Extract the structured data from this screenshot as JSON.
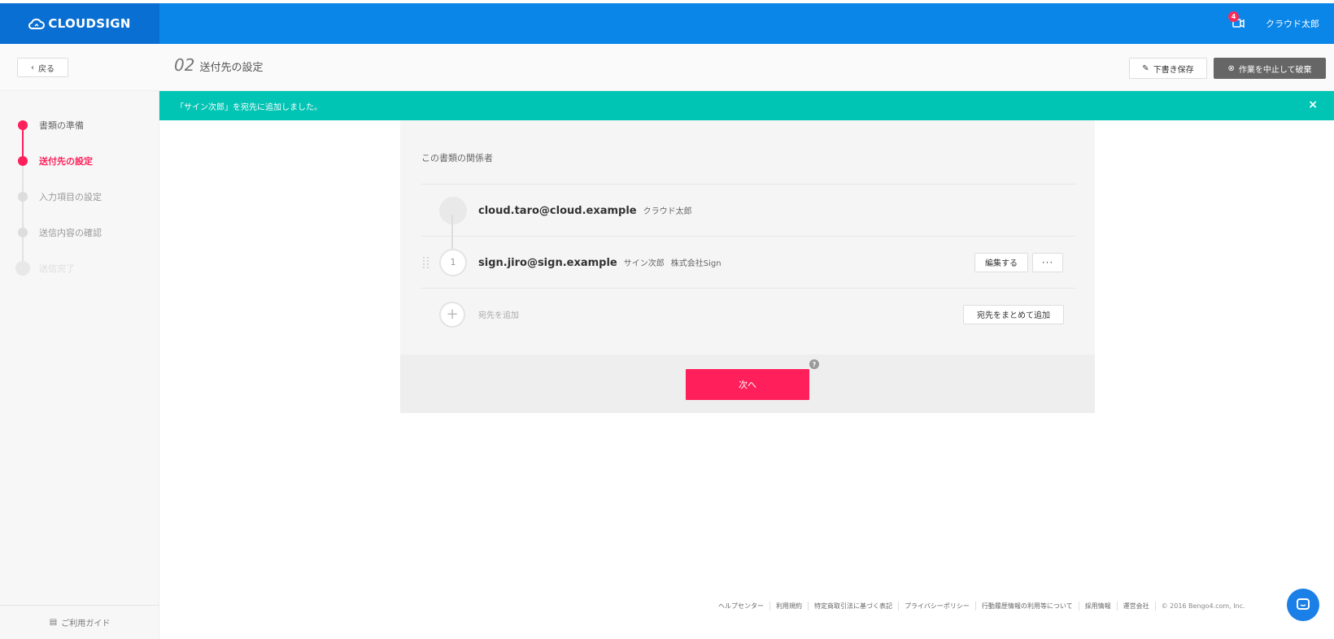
{
  "header": {
    "logo_text": "CLOUDSIGN",
    "notification_count": "4",
    "user_name": "クラウド太郎",
    "brand_color": "#0a86e8"
  },
  "subheader": {
    "back_label": "戻る",
    "step_number": "02",
    "step_title": "送付先の設定",
    "draft_label": "下書き保存",
    "abort_label": "作業を中止して破棄"
  },
  "sidebar": {
    "steps": [
      {
        "label": "書類の準備",
        "state": "done"
      },
      {
        "label": "送付先の設定",
        "state": "current"
      },
      {
        "label": "入力項目の設定",
        "state": "pending"
      },
      {
        "label": "送信内容の確認",
        "state": "pending"
      },
      {
        "label": "送信完了",
        "state": "pending"
      }
    ],
    "guide_label": "ご利用ガイド"
  },
  "toast": {
    "message": "「サイン次郎」を宛先に追加しました。",
    "close": "×",
    "color": "#00c4b4"
  },
  "card": {
    "title": "この書類の関係者",
    "owner": {
      "email": "cloud.taro@cloud.example",
      "name": "クラウド太郎"
    },
    "recipients": [
      {
        "order": "1",
        "email": "sign.jiro@sign.example",
        "name": "サイン次郎",
        "company": "株式会社Sign",
        "edit_label": "編集する",
        "more_label": "···"
      }
    ],
    "add_recipient_label": "宛先を追加",
    "bulk_add_label": "宛先をまとめて追加",
    "next_label": "次へ",
    "help_glyph": "?",
    "accent_color": "#ff1f5a"
  },
  "footer": {
    "links": [
      "ヘルプセンター",
      "利用規約",
      "特定商取引法に基づく表記",
      "プライバシーポリシー",
      "行動履歴情報の利用等について",
      "採用情報",
      "運営会社"
    ],
    "copyright": "© 2016 Bengo4.com, Inc."
  }
}
